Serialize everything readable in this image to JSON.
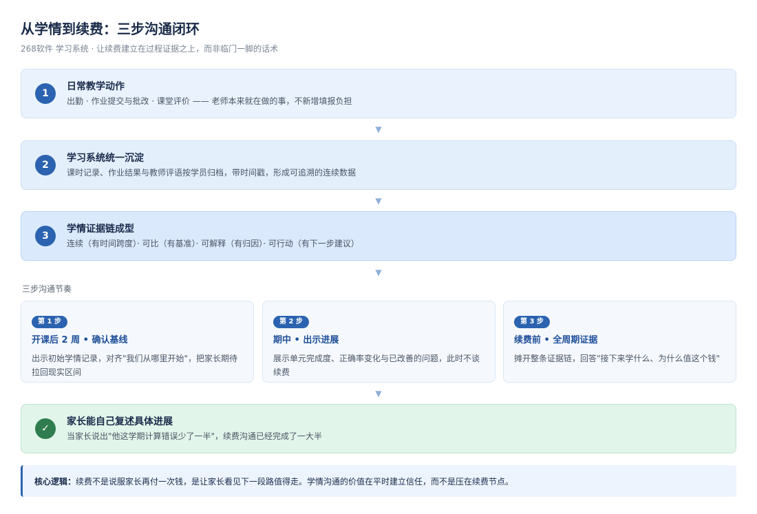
{
  "header": {
    "title": "从学情到续费：三步沟通闭环",
    "subtitle": "268软件 学习系统 · 让续费建立在过程证据之上，而非临门一脚的话术"
  },
  "steps": [
    {
      "number": "1",
      "title": "日常教学动作",
      "desc": "出勤 · 作业提交与批改 · 课堂评价 —— 老师本来就在做的事，不新增填报负担"
    },
    {
      "number": "2",
      "title": "学习系统统一沉淀",
      "desc": "课时记录、作业结果与教师评语按学员归档，带时间戳，形成可追溯的连续数据"
    },
    {
      "number": "3",
      "title": "学情证据链成型",
      "desc": "连续（有时间跨度）· 可比（有基准）· 可解释（有归因）· 可行动（有下一步建议）"
    }
  ],
  "arrow_glyph": "▼",
  "rhythm": {
    "label": "三步沟通节奏",
    "cards": [
      {
        "pill": "第 1 步",
        "title": "开课后 2 周 • 确认基线",
        "desc": "出示初始学情记录，对齐\"我们从哪里开始\"，把家长期待拉回现实区间"
      },
      {
        "pill": "第 2 步",
        "title": "期中 • 出示进展",
        "desc": "展示单元完成度、正确率变化与已改善的问题，此时不谈续费"
      },
      {
        "pill": "第 3 步",
        "title": "续费前 • 全周期证据",
        "desc": "摊开整条证据链，回答\"接下来学什么、为什么值这个钱\""
      }
    ]
  },
  "outcome": {
    "icon": "✓",
    "title": "家长能自己复述具体进展",
    "desc": "当家长说出\"他这学期计算错误少了一半\"，续费沟通已经完成了一大半"
  },
  "core": {
    "label": "核心逻辑",
    "colon": "：",
    "text": "续费不是说服家长再付一次钱，是让家长看见下一段路值得走。学情沟通的价值在平时建立信任，而不是压在续费节点。"
  }
}
